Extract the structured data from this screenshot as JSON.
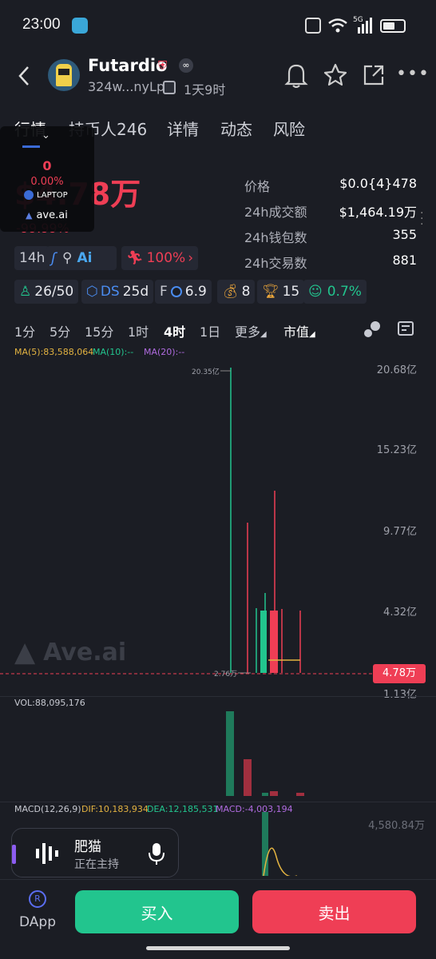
{
  "status": {
    "time": "23:00",
    "network": "5G"
  },
  "header": {
    "token_name": "Futardio",
    "address": "324w...nyLp",
    "age": "1天9时"
  },
  "tabs": [
    {
      "label": "行情"
    },
    {
      "label": "持币人246"
    },
    {
      "label": "详情"
    },
    {
      "label": "动态"
    },
    {
      "label": "风险"
    }
  ],
  "overlay": {
    "value": "0",
    "percent": "0.00%",
    "badge": "LAPTOP",
    "brand": "ave.ai"
  },
  "price_block": {
    "big_price": "$4.78万",
    "change": "-99.99%"
  },
  "stats": [
    {
      "label": "价格",
      "value": "$0.0{4}478"
    },
    {
      "label": "24h成交额",
      "value": "$1,464.19万"
    },
    {
      "label": "24h钱包数",
      "value": "355"
    },
    {
      "label": "24h交易数",
      "value": "881"
    }
  ],
  "tags_row1": {
    "period": "14h",
    "percent": "100%"
  },
  "tags_row2": {
    "holders": "26/50",
    "ds": "DS",
    "ds_value": "25d",
    "f_label": "F",
    "f_value": "6.9",
    "money_value": "8",
    "trophy_value": "15",
    "face_value": "0.7%"
  },
  "timeframes": [
    "1分",
    "5分",
    "15分",
    "1时",
    "4时",
    "1日",
    "更多",
    "市值"
  ],
  "ma": {
    "ma5": "MA(5):83,588,064",
    "ma10": "MA(10):--",
    "ma20": "MA(20):--"
  },
  "axis": {
    "y_labels": [
      "20.68亿",
      "15.23亿",
      "9.77亿",
      "4.32亿",
      "1.13亿"
    ],
    "high_marker": "20.35亿",
    "low_marker": "2.76万",
    "current": "4.78万",
    "watermark": "Ave.ai"
  },
  "volume": {
    "label": "VOL:88,095,176"
  },
  "macd": {
    "label": "MACD(12,26,9)",
    "dif": "DIF:10,183,934",
    "dea": "DEA:12,185,531",
    "macd": "MACD:-4,003,194",
    "axis_value": "4,580.84万"
  },
  "voice": {
    "name": "肥猫",
    "status": "正在主持"
  },
  "bottom": {
    "dapp": "DApp",
    "buy": "买入",
    "sell": "卖出"
  },
  "colors": {
    "green": "#22c58e",
    "red": "#ef3e55",
    "bg": "#1b1d24"
  }
}
